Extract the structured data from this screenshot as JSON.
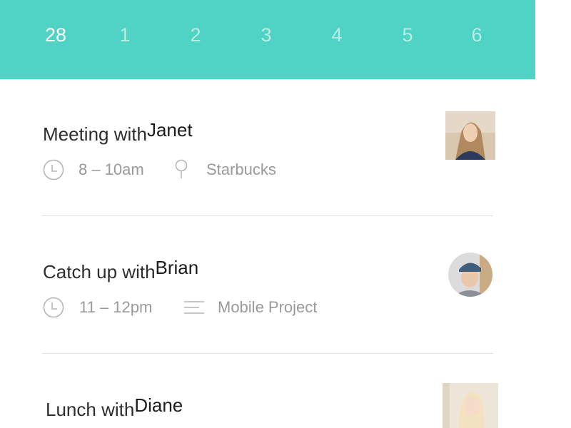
{
  "days": [
    {
      "label": "28",
      "selected": true
    },
    {
      "label": "1",
      "selected": false
    },
    {
      "label": "2",
      "selected": false
    },
    {
      "label": "3",
      "selected": false
    },
    {
      "label": "4",
      "selected": false
    },
    {
      "label": "5",
      "selected": false
    },
    {
      "label": "6",
      "selected": false
    }
  ],
  "events": [
    {
      "prefix": "Meeting with",
      "person": "Janet",
      "time": "8 – 10am",
      "detail": "Starbucks",
      "detail_icon": "location-pin-icon",
      "time_icon": "clock-icon"
    },
    {
      "prefix": "Catch up with",
      "person": "Brian",
      "time": "11 – 12pm",
      "detail": "Mobile Project",
      "detail_icon": "notes-lines-icon",
      "time_icon": "clock-icon"
    },
    {
      "prefix": "Lunch with",
      "person": "Diane"
    }
  ],
  "colors": {
    "accent": "#4fd3c4",
    "text_primary": "#2e2e2e",
    "text_secondary": "#9a9a9a",
    "divider": "#e2e2e2"
  }
}
